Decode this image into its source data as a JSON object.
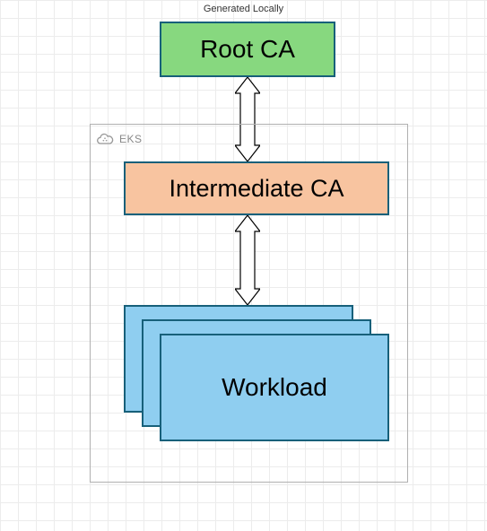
{
  "subtitle": "Generated Locally",
  "root": {
    "label": "Root CA"
  },
  "container": {
    "label": "EKS",
    "icon": "cloud-icon"
  },
  "intermediate": {
    "label": "Intermediate CA"
  },
  "workload": {
    "label": "Workload"
  },
  "chart_data": {
    "type": "diagram",
    "title": "Generated Locally",
    "nodes": [
      {
        "id": "root",
        "label": "Root CA",
        "fill": "#87d87f",
        "stroke": "#17607a"
      },
      {
        "id": "eks",
        "label": "EKS",
        "type": "container",
        "children": [
          "intermediate",
          "workload"
        ]
      },
      {
        "id": "intermediate",
        "label": "Intermediate CA",
        "fill": "#f8c4a0",
        "stroke": "#17607a"
      },
      {
        "id": "workload",
        "label": "Workload",
        "fill": "#8fcef0",
        "stroke": "#17607a",
        "stacked": 3
      }
    ],
    "edges": [
      {
        "from": "root",
        "to": "intermediate",
        "style": "open-double-arrow"
      },
      {
        "from": "intermediate",
        "to": "workload",
        "style": "open-double-arrow"
      }
    ]
  }
}
